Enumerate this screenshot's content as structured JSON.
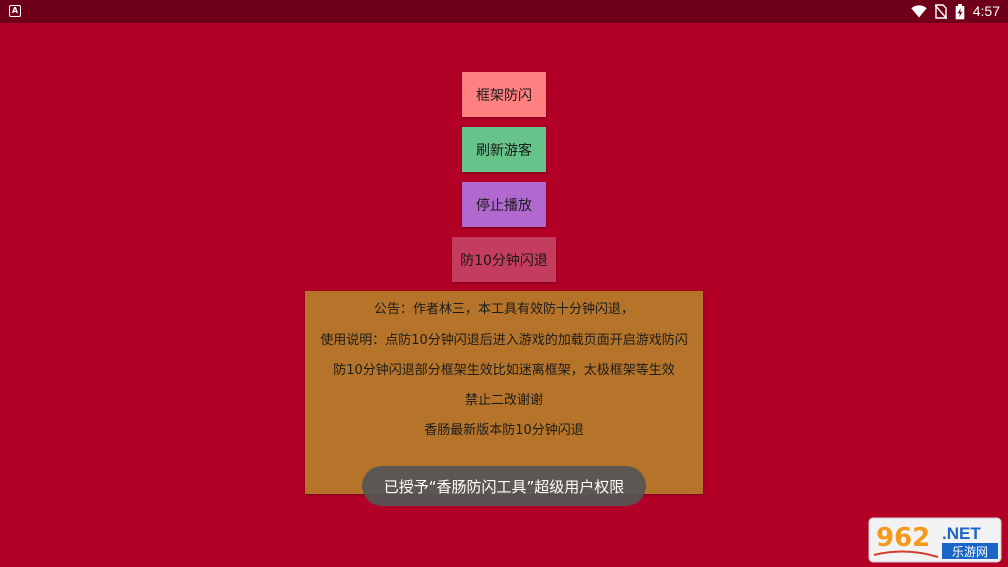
{
  "status_bar": {
    "time": "4:57",
    "left_icon_glyph": "A",
    "icons": [
      "wifi-icon",
      "no-sim-icon",
      "battery-charging-icon"
    ]
  },
  "buttons": {
    "frame_antiflash": "框架防闪",
    "refresh_guest": "刷新游客",
    "stop_playback": "停止播放",
    "anti_10min_flash": "防10分钟闪退"
  },
  "notice": {
    "lines": [
      "公告：作者林三，本工具有效防十分钟闪退，",
      "使用说明：点防10分钟闪退后进入游戏的加载页面开启游戏防闪",
      "防10分钟闪退部分框架生效比如迷离框架，太极框架等生效",
      "禁止二改谢谢",
      "香肠最新版本防10分钟闪退"
    ]
  },
  "toast": "已授予“香肠防闪工具”超级用户权限",
  "watermark": {
    "brand": "962",
    "suffix": ".NET",
    "subtitle": "乐游网"
  },
  "colors": {
    "background": "#b30026",
    "status_bar": "#6e0019",
    "frame_button": "#ff8080",
    "refresh_button": "#66c389",
    "stop_button": "#b169d0",
    "antiflash_button": "#c43c5e",
    "notice_panel": "#b6742a"
  }
}
